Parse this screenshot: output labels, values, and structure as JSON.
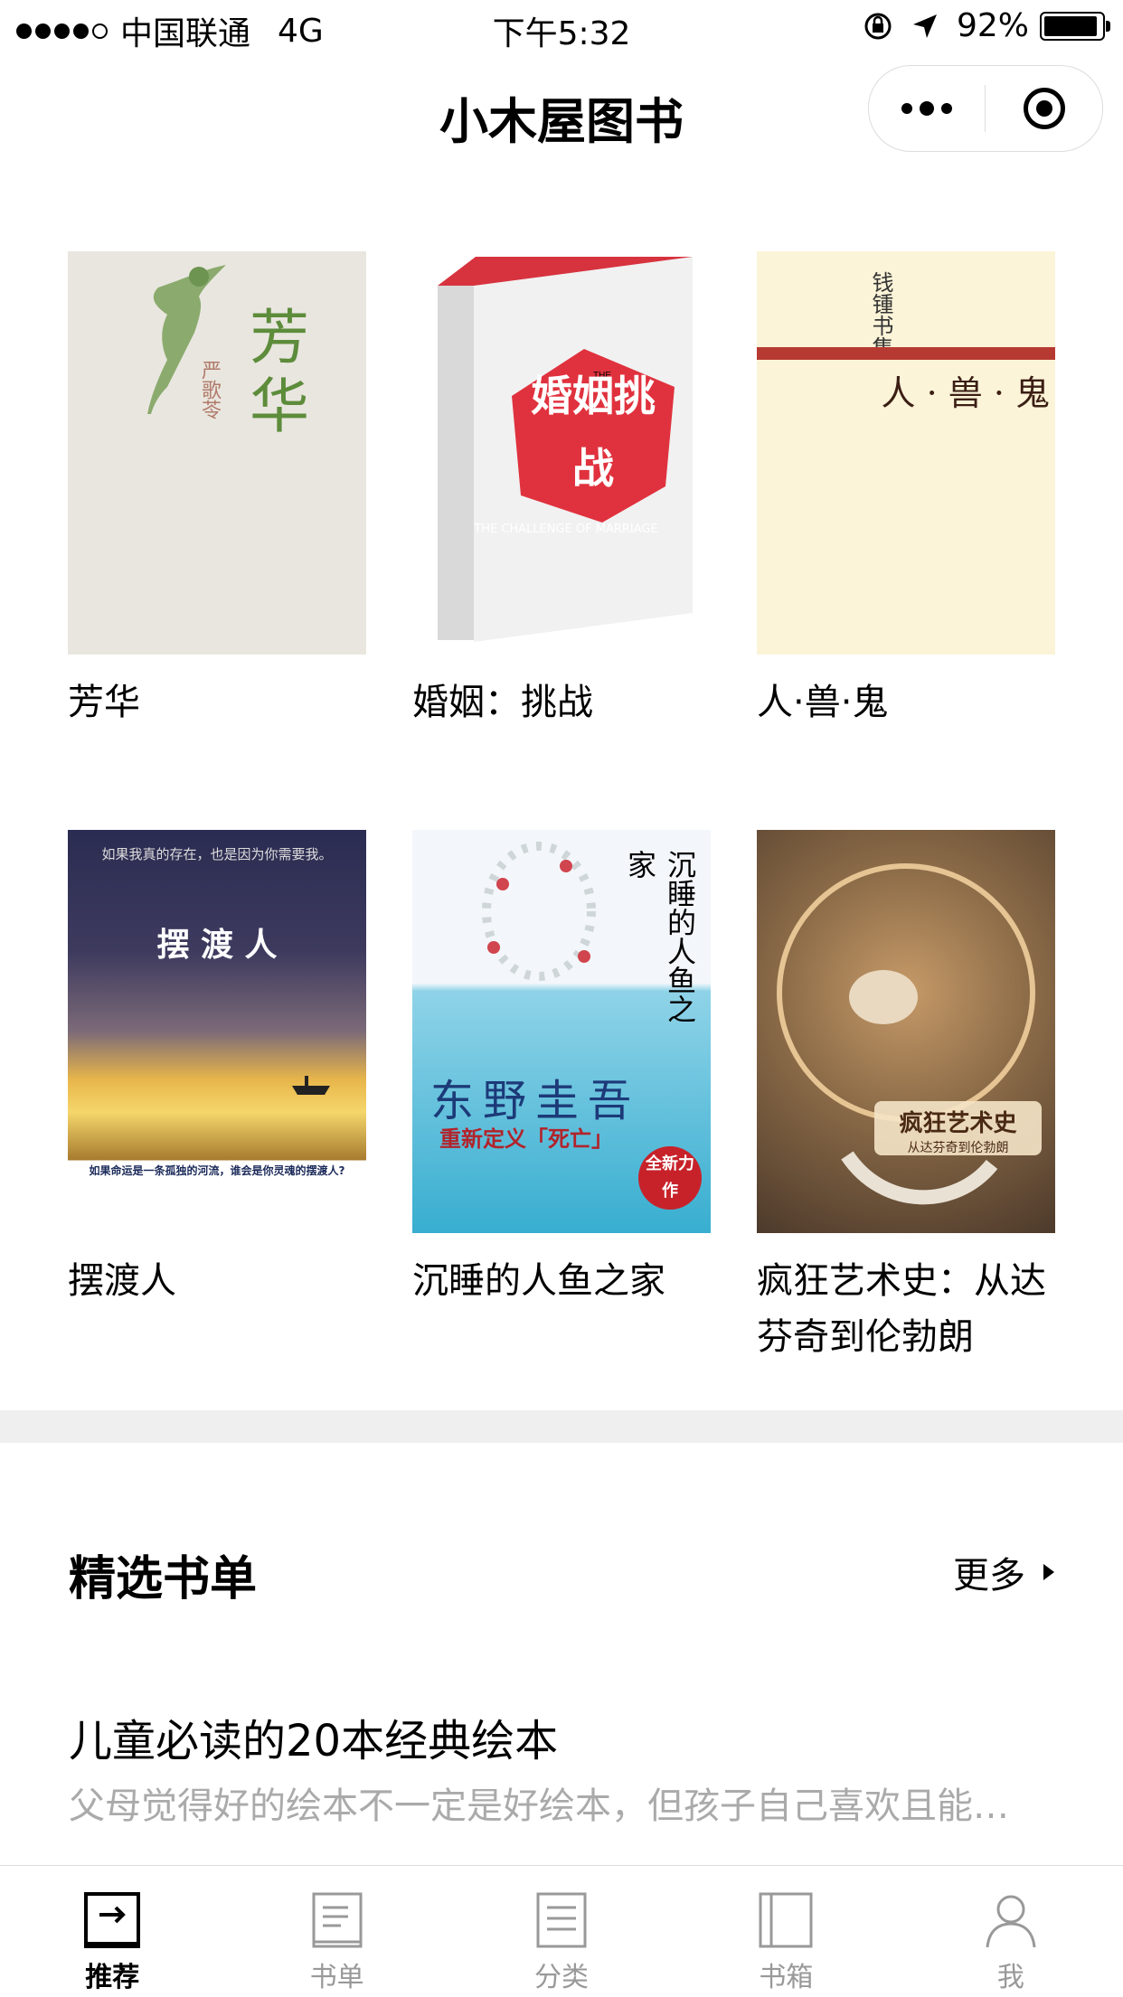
{
  "statusbar": {
    "carrier": "中国联通",
    "network": "4G",
    "time": "下午5:32",
    "battery": "92%"
  },
  "app": {
    "title": "小木屋图书"
  },
  "books": [
    {
      "title": "芳华",
      "cover": {
        "title": "芳华",
        "author": "严歌苓",
        "bg": "#e9e6df"
      }
    },
    {
      "title": "婚姻：挑战",
      "cover": {
        "title": "婚姻挑战",
        "subtitle": "THE CHALLENGE OF MARRIAGE",
        "bg": "#f1f1f1",
        "accent": "#e0323e"
      }
    },
    {
      "title": "人·兽·鬼",
      "cover": {
        "title": "人 · 兽 · 鬼",
        "series": "钱锺书集",
        "bg": "#fbf4d8",
        "accent": "#b63a31"
      }
    },
    {
      "title": "摆渡人",
      "cover": {
        "title": "摆 渡 人",
        "top": "如果我真的存在，也是因为你需要我。",
        "tagline": "如果命运是一条孤独的河流，谁会是你灵魂的摆渡人?",
        "bg": "#262d4f"
      }
    },
    {
      "title": "沉睡的人鱼之家",
      "cover": {
        "title": "沉睡的人鱼之家",
        "author": "东野圭吾",
        "tagline": "重新定义「死亡」",
        "badge": "全新力作",
        "bg": "#f3f7fb",
        "accent": "#38aed0"
      }
    },
    {
      "title": "疯狂艺术史：从达芬奇到伦勃朗",
      "cover": {
        "title": "疯狂艺术史",
        "subtitle": "从达芬奇到伦勃朗",
        "bg": "#7b5a3d"
      }
    }
  ],
  "section": {
    "title": "精选书单",
    "more": "更多"
  },
  "list": {
    "title": "儿童必读的20本经典绘本",
    "desc": "父母觉得好的绘本不一定是好绘本，但孩子自己喜欢且能…"
  },
  "tabs": [
    {
      "label": "推荐",
      "icon": "recommend-icon",
      "active": true
    },
    {
      "label": "书单",
      "icon": "booklist-icon",
      "active": false
    },
    {
      "label": "分类",
      "icon": "category-icon",
      "active": false
    },
    {
      "label": "书箱",
      "icon": "bookbox-icon",
      "active": false
    },
    {
      "label": "我",
      "icon": "user-icon",
      "active": false
    }
  ]
}
